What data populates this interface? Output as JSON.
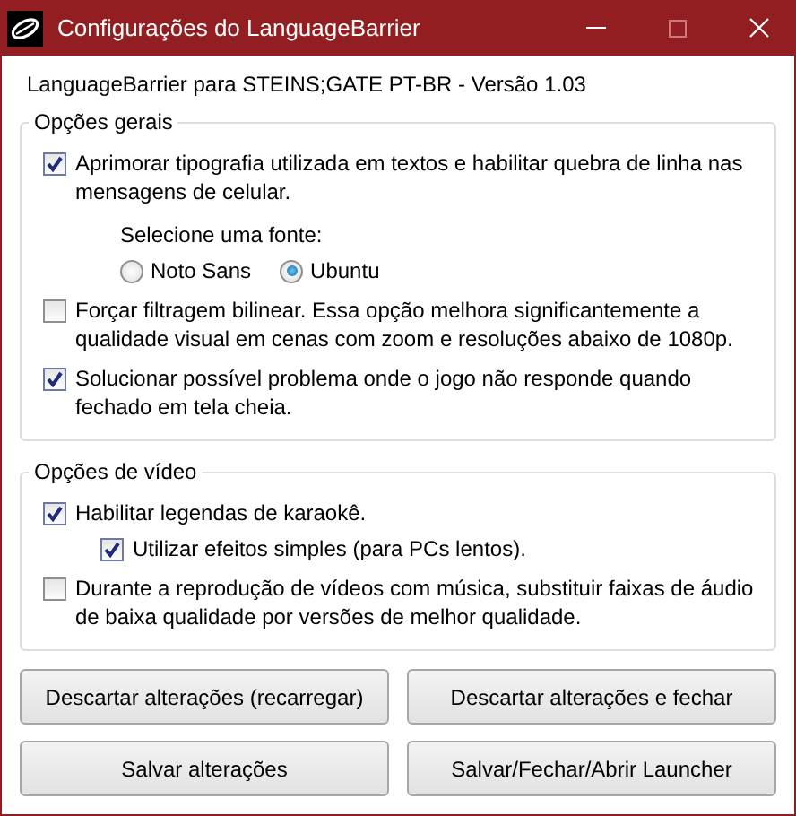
{
  "window": {
    "title": "Configurações do LanguageBarrier"
  },
  "version_label": "LanguageBarrier para STEINS;GATE PT-BR - Versão 1.03",
  "groups": [
    {
      "title": "Opções gerais",
      "options": [
        {
          "kind": "checkbox",
          "label": "Aprimorar tipografia utilizada em textos e habilitar quebra de linha nas mensagens de celular.",
          "checked": true
        },
        {
          "kind": "radio_group",
          "prompt": "Selecione uma fonte:",
          "choices": [
            {
              "label": "Noto Sans",
              "selected": false
            },
            {
              "label": "Ubuntu",
              "selected": true
            }
          ]
        },
        {
          "kind": "checkbox",
          "label": "Forçar filtragem bilinear. Essa opção melhora significantemente a qualidade visual em cenas com zoom e resoluções abaixo de 1080p.",
          "checked": false
        },
        {
          "kind": "checkbox",
          "label": "Solucionar possível problema onde o jogo não responde quando fechado em tela cheia.",
          "checked": true
        }
      ]
    },
    {
      "title": "Opções de vídeo",
      "options": [
        {
          "kind": "checkbox",
          "label": "Habilitar legendas de karaokê.",
          "checked": true,
          "children": [
            {
              "label": "Utilizar efeitos simples (para PCs lentos).",
              "checked": true
            }
          ]
        },
        {
          "kind": "checkbox",
          "label": "Durante a reprodução de vídeos com música, substituir faixas de áudio de baixa qualidade por versões de melhor qualidade.",
          "checked": false
        }
      ]
    }
  ],
  "buttons": [
    "Descartar alterações (recarregar)",
    "Descartar alterações e fechar",
    "Salvar alterações",
    "Salvar/Fechar/Abrir Launcher"
  ]
}
